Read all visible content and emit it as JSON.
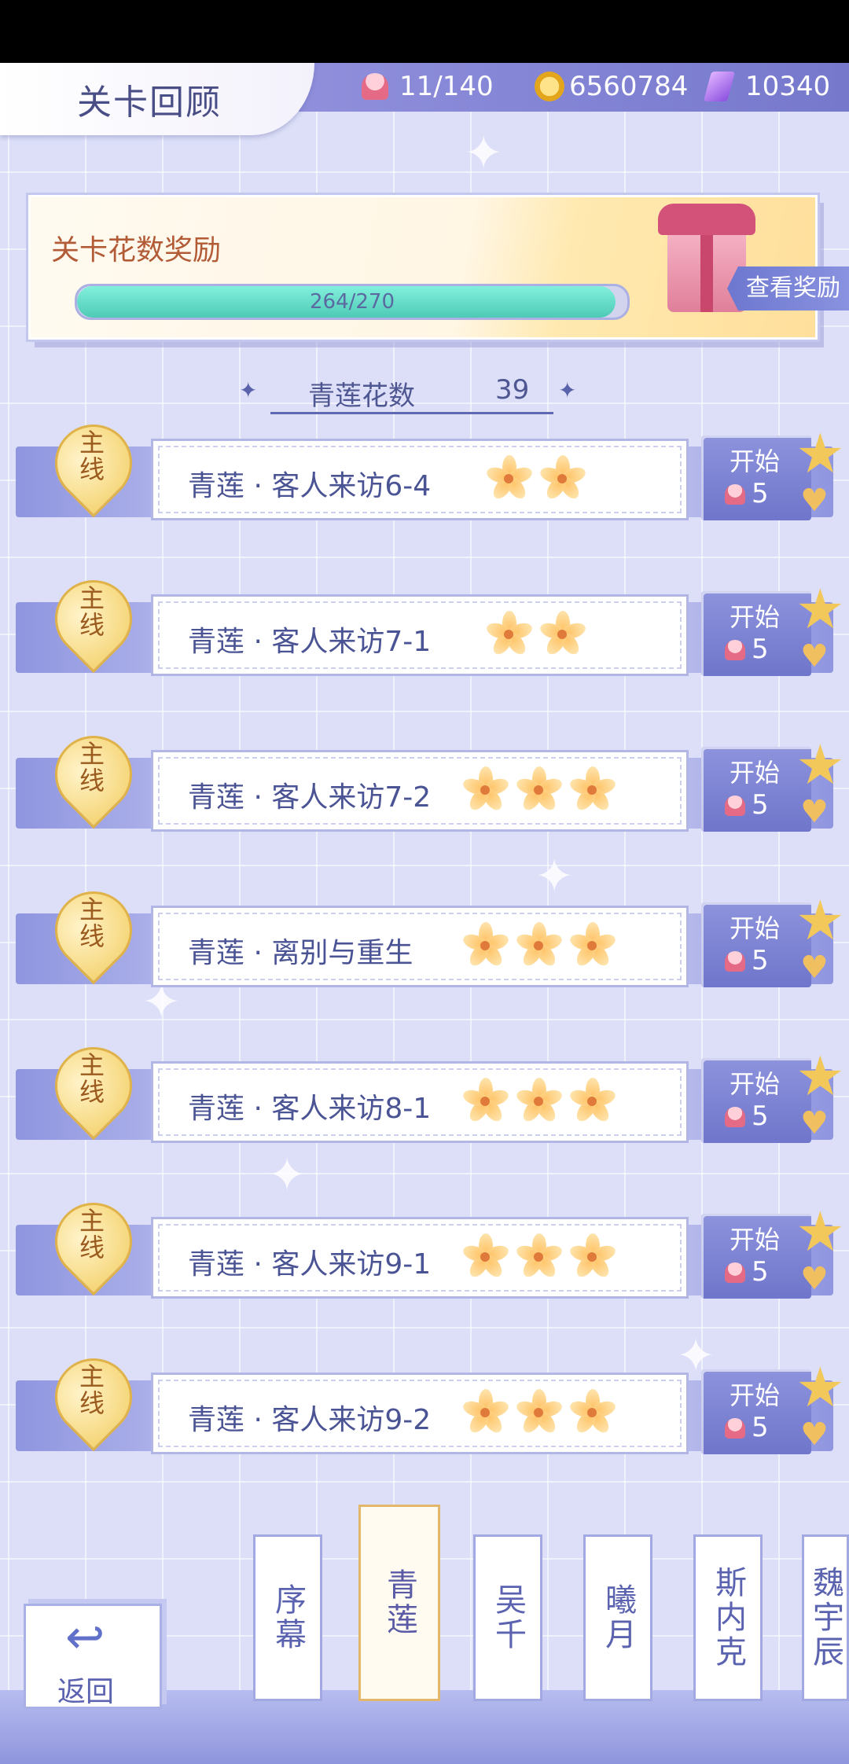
{
  "header": {
    "title": "关卡回顾",
    "stamina": "11/140",
    "coins": "6560784",
    "gems": "10340"
  },
  "reward": {
    "title": "关卡花数奖励",
    "progress_text": "264/270",
    "progress_value": 0.978,
    "view_button": "查看奖励"
  },
  "flower_count": {
    "label": "青莲花数",
    "value": "39"
  },
  "levels": [
    {
      "tag": "主线",
      "name": "青莲 · 客人来访6-4",
      "stars": 2,
      "start": "开始",
      "cost": "5"
    },
    {
      "tag": "主线",
      "name": "青莲 · 客人来访7-1",
      "stars": 2,
      "start": "开始",
      "cost": "5"
    },
    {
      "tag": "主线",
      "name": "青莲 · 客人来访7-2",
      "stars": 3,
      "start": "开始",
      "cost": "5"
    },
    {
      "tag": "主线",
      "name": "青莲 · 离别与重生",
      "stars": 3,
      "start": "开始",
      "cost": "5"
    },
    {
      "tag": "主线",
      "name": "青莲 · 客人来访8-1",
      "stars": 3,
      "start": "开始",
      "cost": "5"
    },
    {
      "tag": "主线",
      "name": "青莲 · 客人来访9-1",
      "stars": 3,
      "start": "开始",
      "cost": "5"
    },
    {
      "tag": "主线",
      "name": "青莲 · 客人来访9-2",
      "stars": 3,
      "start": "开始",
      "cost": "5"
    }
  ],
  "tabs": [
    {
      "label": "序幕",
      "active": false
    },
    {
      "label": "青莲",
      "active": true
    },
    {
      "label": "吴千",
      "active": false
    },
    {
      "label": "曦月",
      "active": false
    },
    {
      "label": "斯内克",
      "active": false
    },
    {
      "label": "魏宇辰",
      "active": false
    }
  ],
  "back_label": "返回",
  "icons": {
    "stamina": "cupcake-icon",
    "coin": "coin-icon",
    "gem": "gem-icon",
    "star": "flower-star-icon",
    "badge": "swan-star-icon"
  }
}
